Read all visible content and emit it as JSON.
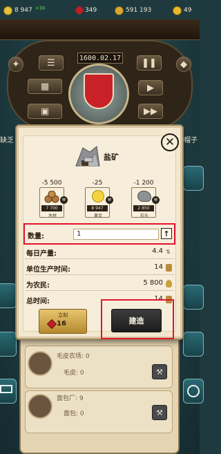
{
  "top_bar": {
    "gold": "8 947",
    "gold_delta": "+3K",
    "rubies": "349",
    "money": "591 193",
    "stars": "49"
  },
  "game": {
    "date": "1600.02.17",
    "left_label": "缺乏",
    "right_label": "帽子"
  },
  "dialog": {
    "title": "盐矿",
    "costs": [
      {
        "amount": "-5 500",
        "stock": "7 700",
        "name": "木材"
      },
      {
        "amount": "-25",
        "stock": "8 947",
        "name": "黄金"
      },
      {
        "amount": "-1 200",
        "stock": "2 850",
        "name": "石头"
      }
    ],
    "quantity_label": "数量:",
    "quantity_value": "1",
    "stats": [
      {
        "label": "每日产量:",
        "value": "4.4"
      },
      {
        "label": "单位生产时间:",
        "value": "14"
      },
      {
        "label": "为农民:",
        "value": "5 800"
      },
      {
        "label": "总时间:",
        "value": "14"
      }
    ],
    "instant_label": "立刻",
    "instant_cost": "16",
    "build_label": "建造"
  },
  "buildings_list": [
    {
      "name": "毛皮农场: 0",
      "product": "毛皮: 0"
    },
    {
      "name": "面包厂: 9",
      "product": "面包: 0"
    }
  ],
  "colors": {
    "highlight": "#e0152a",
    "parchment": "#f3e8cf",
    "build_button": "#1c1c1c",
    "instant_button": "#d4aa4c"
  }
}
